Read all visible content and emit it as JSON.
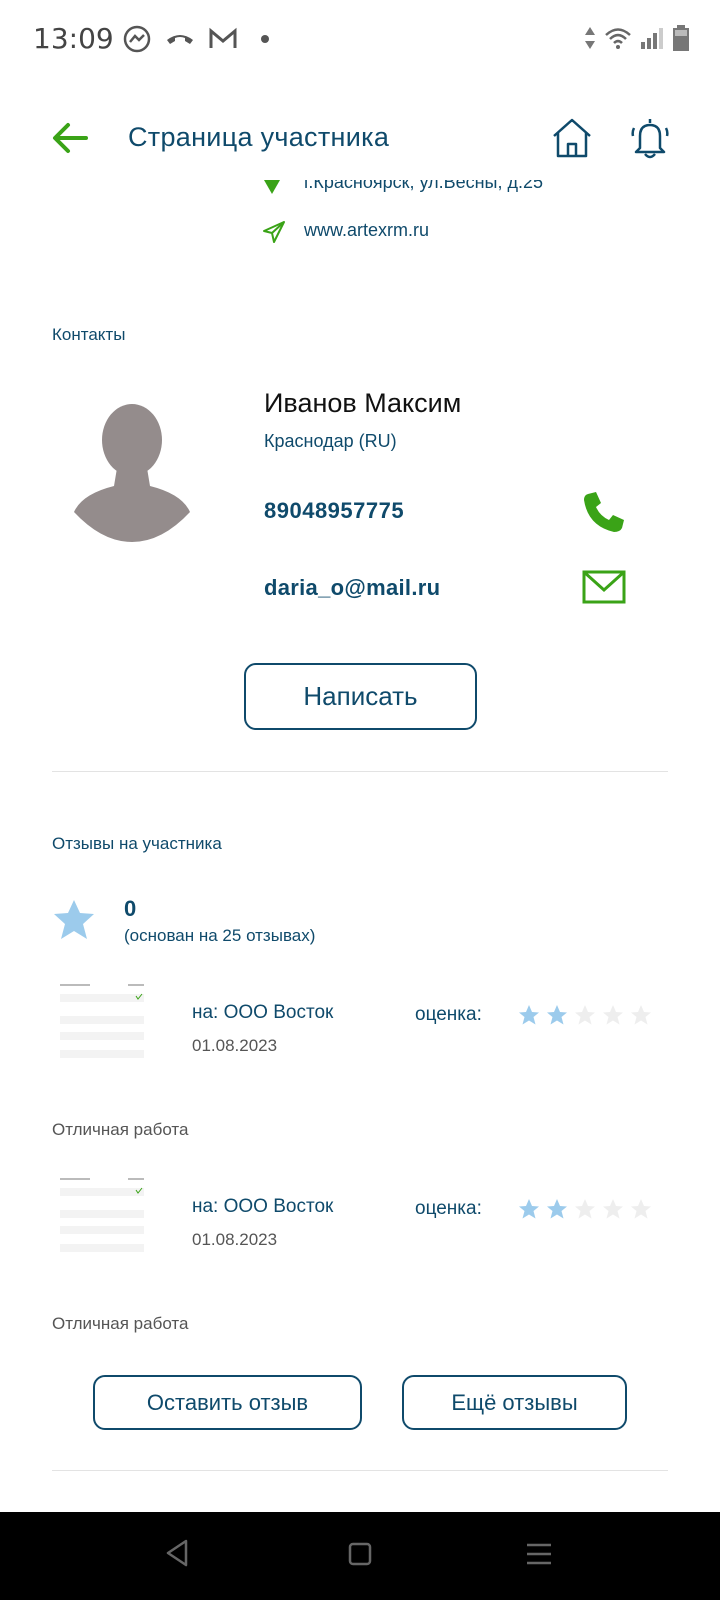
{
  "status_bar": {
    "time": "13:09"
  },
  "header": {
    "title": "Страница участника"
  },
  "company": {
    "address": "г.Красноярск, ул.Весны, д.25",
    "website": "www.artexrm.ru"
  },
  "contacts": {
    "section_label": "Контакты",
    "name": "Иванов Максим",
    "city": "Краснодар (RU)",
    "phone": "89048957775",
    "email": "daria_o@mail.ru",
    "write_button": "Написать"
  },
  "reviews": {
    "section_label": "Отзывы на участника",
    "rating_value": "0",
    "rating_basis": "(основан на 25 отзывах)",
    "items": [
      {
        "target": "на: ООО Восток",
        "date": "01.08.2023",
        "score_label": "оценка:",
        "stars": 2,
        "max_stars": 5,
        "comment": "Отличная работа"
      },
      {
        "target": "на: ООО Восток",
        "date": "01.08.2023",
        "score_label": "оценка:",
        "stars": 2,
        "max_stars": 5,
        "comment": "Отличная работа"
      }
    ],
    "leave_review_button": "Оставить отзыв",
    "more_reviews_button": "Ещё отзывы"
  },
  "colors": {
    "accent_green": "#3aa317",
    "primary_blue": "#0f4a6b",
    "star_filled": "#9ccbec",
    "star_empty": "#eeeeee"
  }
}
